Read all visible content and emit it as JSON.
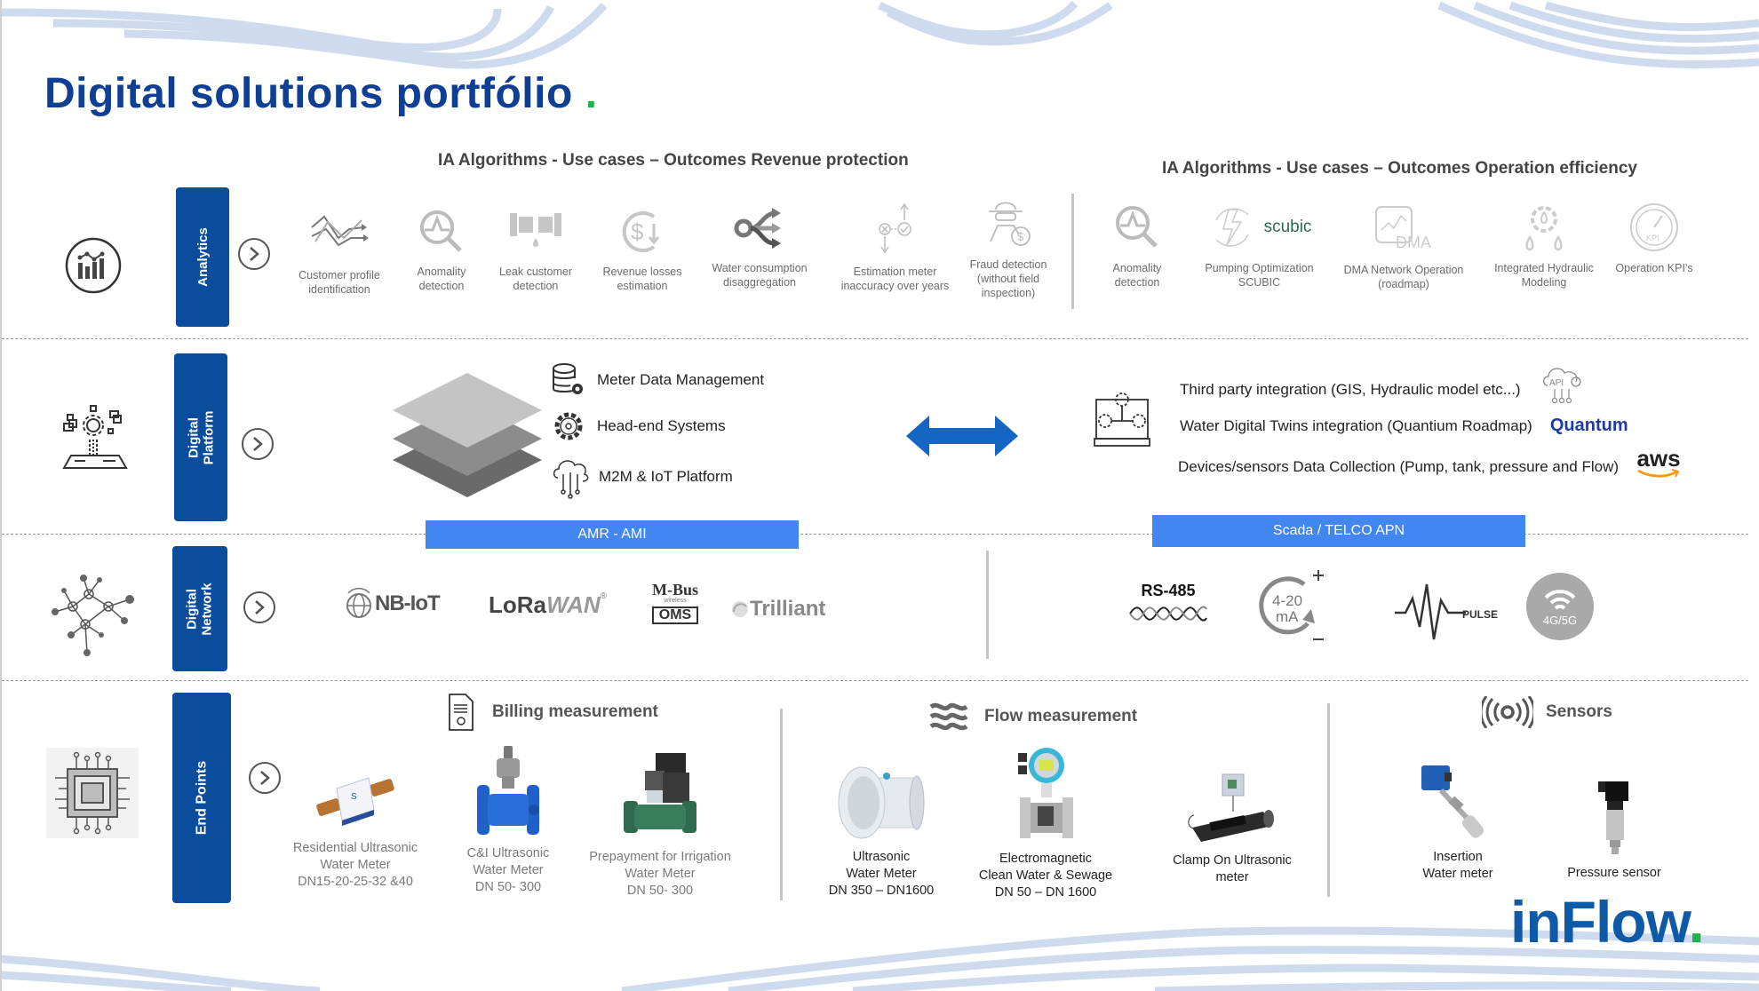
{
  "title": "Digital solutions portfólio",
  "title_dot": ".",
  "colors": {
    "brand_blue": "#0e3f94",
    "section_box": "#0a4d9c",
    "bar_blue": "#4286f0",
    "accent_green": "#21b24b",
    "arrow_blue": "#1466c3"
  },
  "analytics": {
    "label": "Analytics",
    "icon": "analytics-chart-icon",
    "revenue_header": "IA Algorithms - Use cases – Outcomes Revenue protection",
    "operation_header": "IA Algorithms - Use cases – Outcomes Operation efficiency",
    "revenue_items": [
      {
        "icon": "trend-arrows-icon",
        "label": [
          "Customer profile",
          "identification"
        ]
      },
      {
        "icon": "anomaly-search-icon",
        "label": [
          "Anomality",
          "detection"
        ]
      },
      {
        "icon": "pipe-leak-icon",
        "label": [
          "Leak customer",
          "detection"
        ]
      },
      {
        "icon": "dollar-down-icon",
        "label": [
          "Revenue losses",
          "estimation"
        ]
      },
      {
        "icon": "split-arrows-icon",
        "label": [
          "Water consumption",
          "disaggregation"
        ]
      },
      {
        "icon": "meter-accuracy-icon",
        "label": [
          "Estimation meter",
          "inaccuracy over years"
        ]
      },
      {
        "icon": "spy-dollar-icon",
        "label": [
          "Fraud detection",
          "(without field",
          "inspection)"
        ]
      }
    ],
    "operation_items": [
      {
        "icon": "anomaly-search-icon",
        "label": [
          "Anomality",
          "detection"
        ]
      },
      {
        "icon": "lightning-cycle-icon",
        "label": [
          "Pumping Optimization",
          "SCUBIC"
        ],
        "logo": "scubic"
      },
      {
        "icon": "dma-screen-icon",
        "label": [
          "DMA Network Operation",
          "(roadmap)"
        ],
        "icon_text": "DMA"
      },
      {
        "icon": "gear-drops-icon",
        "label": [
          "Integrated Hydraulic",
          "Modeling"
        ]
      },
      {
        "icon": "kpi-gauge-icon",
        "label": [
          "Operation KPI's"
        ],
        "icon_text": "KPI"
      }
    ]
  },
  "platform": {
    "label": [
      "Digital",
      "Platform"
    ],
    "left_items": [
      {
        "icon": "database-gear-icon",
        "text": "Meter Data Management"
      },
      {
        "icon": "gear-icon",
        "text": "Head-end Systems"
      },
      {
        "icon": "cloud-circuit-icon",
        "text": "M2M & IoT Platform"
      }
    ],
    "right_items": [
      {
        "text": "Third party integration (GIS, Hydraulic model etc...)",
        "badge": "API"
      },
      {
        "text": "Water Digital Twins integration (Quantium Roadmap)",
        "badge": "Quantum"
      },
      {
        "text": "Devices/sensors Data Collection (Pump, tank, pressure and Flow)",
        "badge": "aws"
      }
    ],
    "left_bar": "AMR - AMI",
    "right_bar": "Scada / TELCO APN"
  },
  "network": {
    "label": [
      "Digital",
      "Network"
    ],
    "left_protocols": [
      "NB-IoT",
      "LoRaWAN",
      "M-Bus OMS",
      "Trilliant"
    ],
    "lora_a": "LoRa",
    "lora_b": "WAN",
    "mbus_top": "M-Bus",
    "mbus_small": "wireless",
    "mbus_bottom": "OMS",
    "right_protocols": {
      "rs485": "RS-485",
      "ma_top": "4-20",
      "ma_bottom": "mA",
      "pulse": "PULSE",
      "cell": "4G/5G"
    }
  },
  "endpoints": {
    "label": "End Points",
    "billing": {
      "title": "Billing measurement",
      "products": [
        {
          "lines": [
            "Residential Ultrasonic",
            "Water Meter",
            "DN15-20-25-32 &40"
          ]
        },
        {
          "lines": [
            "C&I Ultrasonic",
            "Water Meter",
            "DN 50- 300"
          ]
        },
        {
          "lines": [
            "Prepayment for Irrigation",
            "Water Meter",
            "DN 50- 300"
          ]
        }
      ]
    },
    "flow": {
      "title": "Flow measurement",
      "products": [
        {
          "lines": [
            "Ultrasonic",
            "Water Meter",
            "DN 350 – DN1600"
          ]
        },
        {
          "lines": [
            "Electromagnetic",
            "Clean Water & Sewage",
            "DN 50 – DN 1600"
          ]
        },
        {
          "lines": [
            "Clamp On Ultrasonic",
            "meter"
          ]
        }
      ]
    },
    "sensors": {
      "title": "Sensors",
      "products": [
        {
          "lines": [
            "Insertion",
            "Water meter"
          ]
        },
        {
          "lines": [
            "Pressure sensor"
          ]
        }
      ]
    }
  },
  "logo": {
    "text": "inFlow",
    "dot": "."
  }
}
